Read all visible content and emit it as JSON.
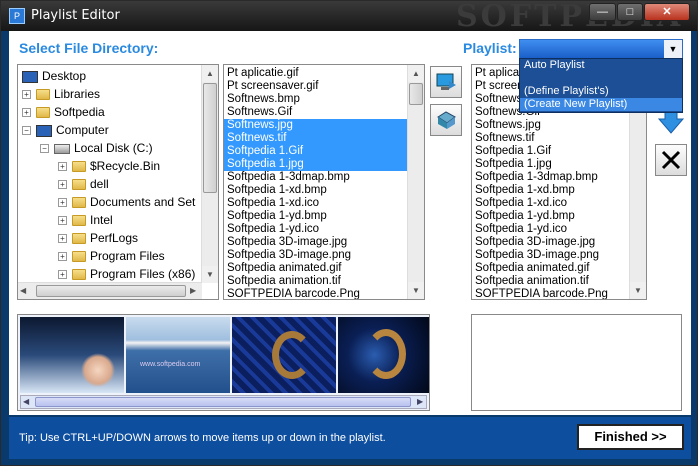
{
  "window": {
    "title": "Playlist Editor",
    "watermark": "SOFTPEDIA",
    "app_icon": "P",
    "minimize": "—",
    "maximize": "□",
    "close": "✕"
  },
  "directory": {
    "label": "Select File Directory:",
    "tree": [
      {
        "label": "Desktop",
        "icon": "monitor-icon"
      },
      {
        "label": "Libraries",
        "icon": "folder-icon"
      },
      {
        "label": "Softpedia",
        "icon": "folder-icon"
      },
      {
        "label": "Computer",
        "icon": "computer-icon"
      },
      {
        "label": "Local Disk (C:)",
        "icon": "drive-icon"
      },
      {
        "label": "$Recycle.Bin",
        "icon": "folder-icon"
      },
      {
        "label": "dell",
        "icon": "folder-icon"
      },
      {
        "label": "Documents and Set",
        "icon": "folder-icon"
      },
      {
        "label": "Intel",
        "icon": "folder-icon"
      },
      {
        "label": "PerfLogs",
        "icon": "folder-icon"
      },
      {
        "label": "Program Files",
        "icon": "folder-icon"
      },
      {
        "label": "Program Files (x86)",
        "icon": "folder-icon"
      }
    ]
  },
  "files": {
    "items": [
      {
        "name": "Pt aplicatie.gif",
        "selected": false
      },
      {
        "name": "Pt screensaver.gif",
        "selected": false
      },
      {
        "name": "Softnews.bmp",
        "selected": false
      },
      {
        "name": "Softnews.Gif",
        "selected": false
      },
      {
        "name": "Softnews.jpg",
        "selected": true
      },
      {
        "name": "Softnews.tif",
        "selected": true
      },
      {
        "name": "Softpedia 1.Gif",
        "selected": true
      },
      {
        "name": "Softpedia 1.jpg",
        "selected": true
      },
      {
        "name": "Softpedia 1-3dmap.bmp",
        "selected": false
      },
      {
        "name": "Softpedia 1-xd.bmp",
        "selected": false
      },
      {
        "name": "Softpedia 1-xd.ico",
        "selected": false
      },
      {
        "name": "Softpedia 1-yd.bmp",
        "selected": false
      },
      {
        "name": "Softpedia 1-yd.ico",
        "selected": false
      },
      {
        "name": "Softpedia 3D-image.jpg",
        "selected": false
      },
      {
        "name": "Softpedia 3D-image.png",
        "selected": false
      },
      {
        "name": "Softpedia animated.gif",
        "selected": false
      },
      {
        "name": "Softpedia animation.tif",
        "selected": false
      },
      {
        "name": "SOFTPEDIA barcode.Png",
        "selected": false
      }
    ]
  },
  "playlist": {
    "label": "Playlist:",
    "options": [
      "Auto Playlist",
      "",
      "(Define Playlist's)",
      "(Create New Playlist)"
    ],
    "selected_option": "(Create New Playlist)",
    "items": [
      "Pt aplicatie.gif",
      "Pt screensaver.gif",
      "Softnews.bmp",
      "Softnews.Gif",
      "Softnews.jpg",
      "Softnews.tif",
      "Softpedia 1.Gif",
      "Softpedia 1.jpg",
      "Softpedia 1-3dmap.bmp",
      "Softpedia 1-xd.bmp",
      "Softpedia 1-xd.ico",
      "Softpedia 1-yd.bmp",
      "Softpedia 1-yd.ico",
      "Softpedia 3D-image.jpg",
      "Softpedia 3D-image.png",
      "Softpedia animated.gif",
      "Softpedia animation.tif",
      "SOFTPEDIA barcode.Png"
    ]
  },
  "buttons": {
    "add_files": "add-to-playlist-icon",
    "remove": "remove-icon",
    "move_down": "arrow-down-icon",
    "delete": "delete-x-icon"
  },
  "footer": {
    "tip": "Tip: Use CTRL+UP/DOWN arrows to move items up or down in the playlist.",
    "finish_label": "Finished >>"
  },
  "thumbnail_caption": "www.softpedia.com"
}
